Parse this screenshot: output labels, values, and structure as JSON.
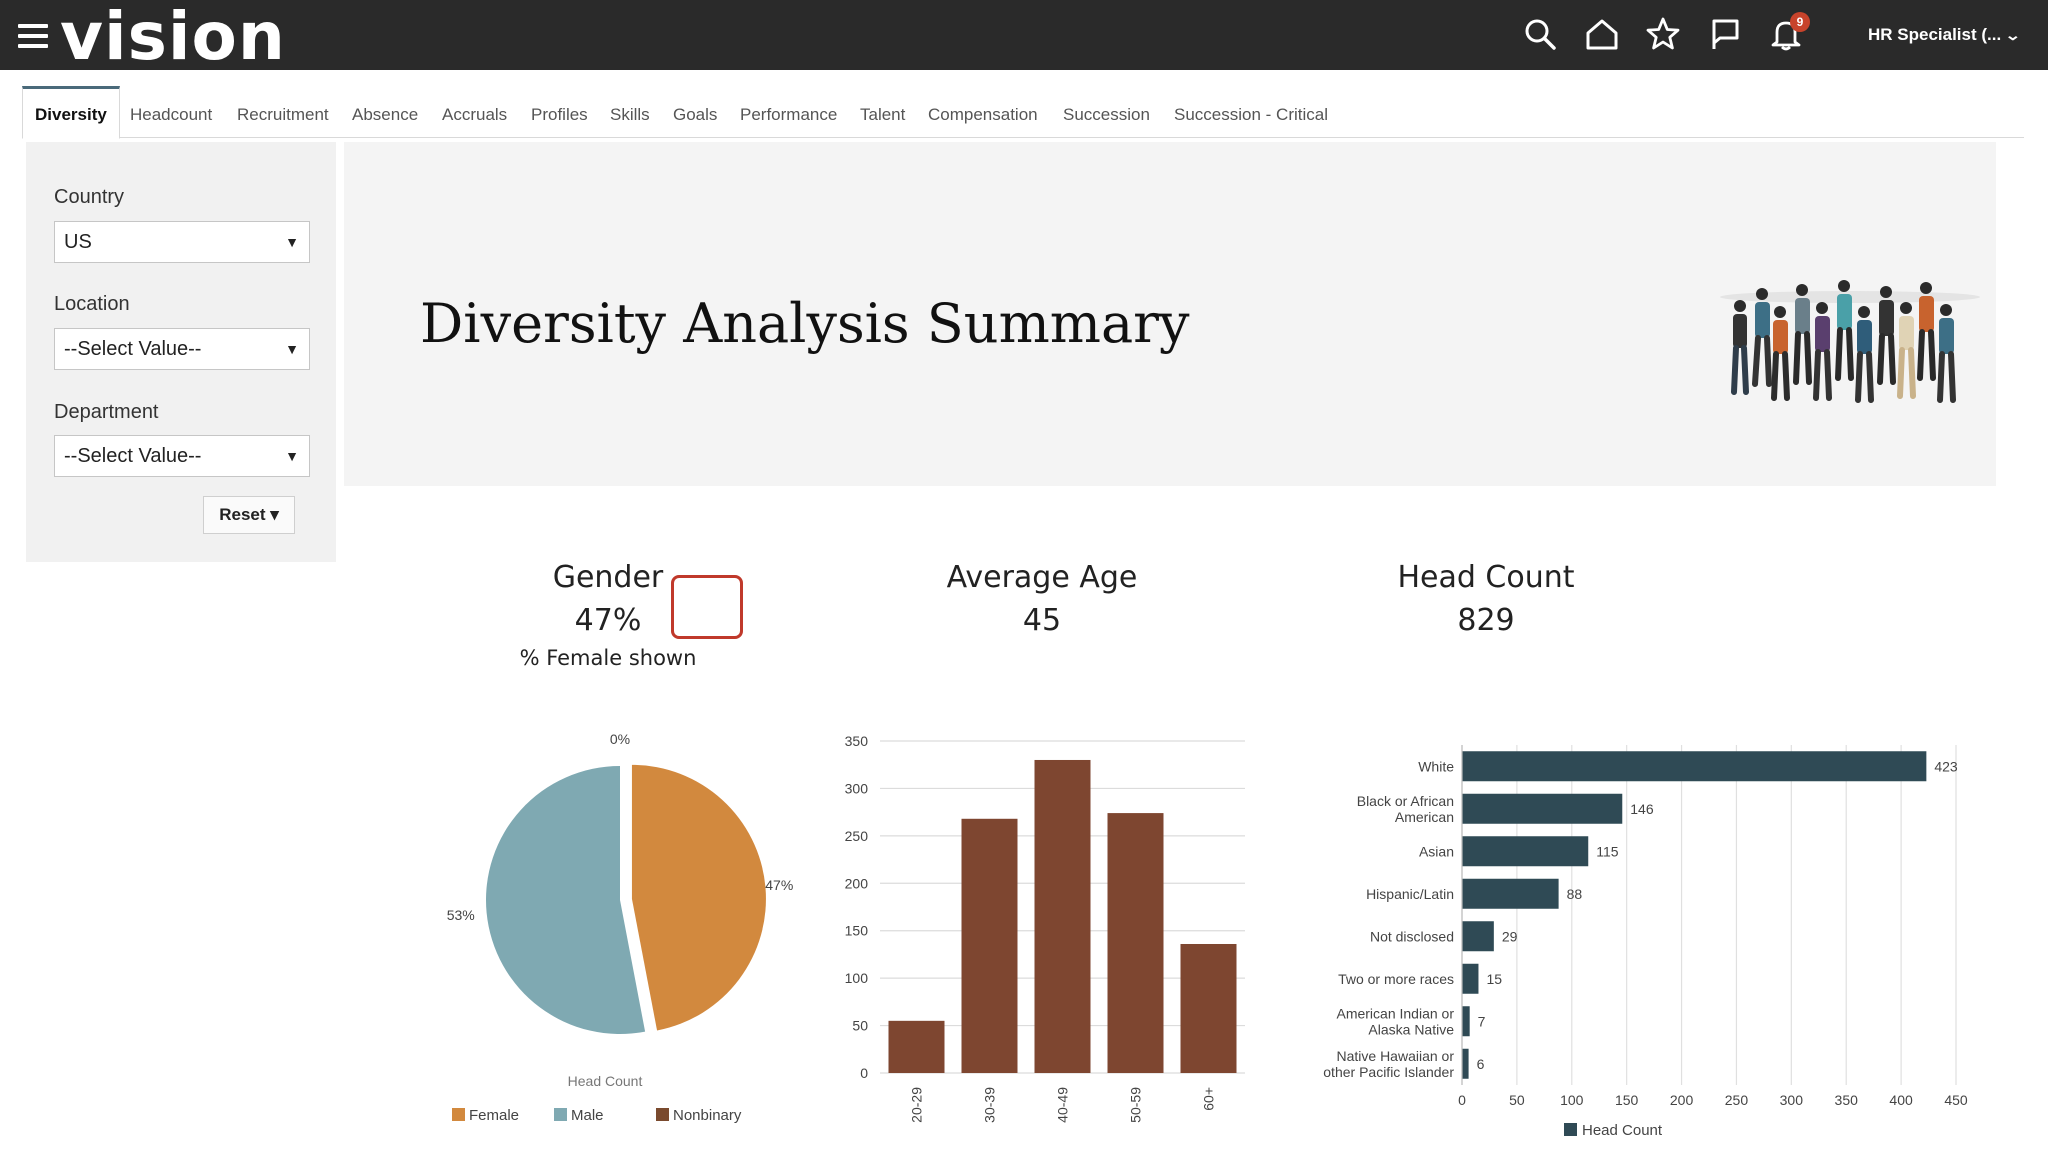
{
  "header": {
    "logo": "vision",
    "notification_count": "9",
    "user_menu_label": "HR Specialist (..."
  },
  "tabs": [
    "Diversity",
    "Headcount",
    "Recruitment",
    "Absence",
    "Accruals",
    "Profiles",
    "Skills",
    "Goals",
    "Performance",
    "Talent",
    "Compensation",
    "Succession",
    "Succession - Critical"
  ],
  "filters": {
    "country_label": "Country",
    "country_value": "US",
    "location_label": "Location",
    "location_value": "--Select Value--",
    "department_label": "Department",
    "department_value": "--Select Value--",
    "reset_label": "Reset ▾"
  },
  "banner": {
    "title": "Diversity Analysis Summary"
  },
  "kpis": {
    "gender": {
      "title": "Gender",
      "value": "47%",
      "subtitle": "% Female shown"
    },
    "age": {
      "title": "Average Age",
      "value": "45"
    },
    "headcount": {
      "title": "Head Count",
      "value": "829"
    }
  },
  "colors": {
    "female": "#d2893e",
    "male": "#7fa9b2",
    "nonbinary": "#7a4a2e",
    "age_bar": "#7e4630",
    "ethnicity_bar": "#2f4a55",
    "header_bg": "#2a2a2a",
    "highlight": "#c0392b"
  },
  "icons": [
    "menu-icon",
    "search-icon",
    "home-icon",
    "star-icon",
    "flag-icon",
    "bell-icon",
    "chevron-down-icon"
  ],
  "chart_data": [
    {
      "type": "pie",
      "title": "",
      "xlabel": "Head Count",
      "categories": [
        "Female",
        "Male",
        "Nonbinary"
      ],
      "values": [
        47,
        53,
        0
      ],
      "labels": [
        "47%",
        "53%",
        "0%"
      ],
      "legend": "bottom"
    },
    {
      "type": "bar",
      "categories": [
        "20-29",
        "30-39",
        "40-49",
        "50-59",
        "60+"
      ],
      "values": [
        55,
        268,
        330,
        274,
        136
      ],
      "ylim": [
        0,
        350
      ],
      "yticks": [
        0,
        50,
        100,
        150,
        200,
        250,
        300,
        350
      ],
      "grid": true
    },
    {
      "type": "bar",
      "orientation": "horizontal",
      "categories": [
        "White",
        "Black or African American",
        "Asian",
        "Hispanic/Latin",
        "Not disclosed",
        "Two or more races",
        "American Indian or Alaska Native",
        "Native Hawaiian or other Pacific Islander"
      ],
      "category_lines": [
        [
          "White"
        ],
        [
          "Black or African",
          "American"
        ],
        [
          "Asian"
        ],
        [
          "Hispanic/Latin"
        ],
        [
          "Not disclosed"
        ],
        [
          "Two or more races"
        ],
        [
          "American Indian or",
          "Alaska Native"
        ],
        [
          "Native Hawaiian or",
          "other Pacific Islander"
        ]
      ],
      "values": [
        423,
        146,
        115,
        88,
        29,
        15,
        7,
        6
      ],
      "xlim": [
        0,
        450
      ],
      "xticks": [
        0,
        50,
        100,
        150,
        200,
        250,
        300,
        350,
        400,
        450
      ],
      "series": [
        {
          "name": "Head Count"
        }
      ],
      "legend": "bottom",
      "grid": true
    }
  ]
}
